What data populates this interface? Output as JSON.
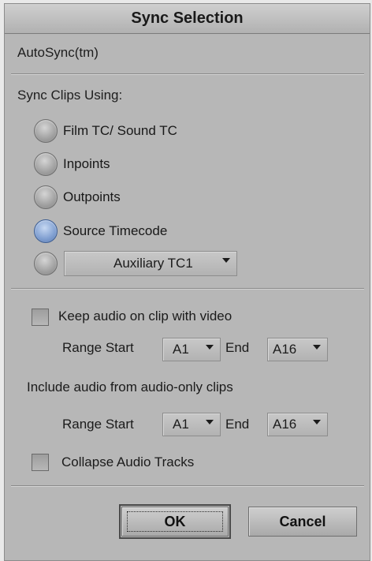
{
  "dialog": {
    "title": "Sync Selection",
    "autosync_label": "AutoSync(tm)",
    "sync_clips_using_label": "Sync Clips Using:",
    "options": [
      {
        "label": "Film TC/ Sound TC",
        "selected": false
      },
      {
        "label": "Inpoints",
        "selected": false
      },
      {
        "label": "Outpoints",
        "selected": false
      },
      {
        "label": "Source Timecode",
        "selected": true
      }
    ],
    "auxiliary": {
      "value": "Auxiliary TC1",
      "selected": false
    },
    "keep_audio": {
      "label": "Keep audio on clip with video",
      "checked": false,
      "range_start_label": "Range Start",
      "range_start_value": "A1",
      "end_label": "End",
      "end_value": "A16"
    },
    "include_audio": {
      "label": "Include audio from audio-only clips",
      "range_start_label": "Range Start",
      "range_start_value": "A1",
      "end_label": "End",
      "end_value": "A16"
    },
    "collapse_audio": {
      "label": "Collapse Audio Tracks",
      "checked": false
    },
    "buttons": {
      "ok": "OK",
      "cancel": "Cancel"
    }
  },
  "colors": {
    "dialog_bg": "#b7b7b7",
    "selected_radio": "#7f9ed0"
  }
}
